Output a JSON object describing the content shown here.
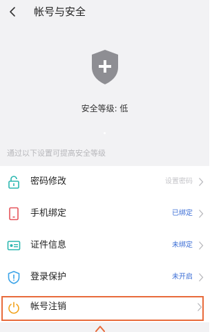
{
  "header": {
    "title": "帐号与安全",
    "back_icon": "chevron-left-icon"
  },
  "security": {
    "icon": "shield-plus-icon",
    "level_text": "安全等级: 低",
    "hint": "通过以下设置可提高安全等级"
  },
  "rows": [
    {
      "label": "密码修改",
      "status": "设置密码",
      "icon": "lock-icon",
      "icon_color": "#2bb7b0"
    },
    {
      "label": "手机绑定",
      "status": "已绑定",
      "icon": "phone-icon",
      "icon_color": "#e5535a"
    },
    {
      "label": "证件信息",
      "status": "未绑定",
      "icon": "id-card-icon",
      "icon_color": "#2bb7b0"
    },
    {
      "label": "登录保护",
      "status": "未开启",
      "icon": "shield-alert-icon",
      "icon_color": "#3aa3e8"
    },
    {
      "label": "帐号注销",
      "status": "",
      "icon": "power-icon",
      "icon_color": "#f2a21b"
    }
  ],
  "colors": {
    "highlight_border": "#e86a3a",
    "status_blue": "#3d6fd6",
    "status_muted": "#c4c4c8"
  }
}
